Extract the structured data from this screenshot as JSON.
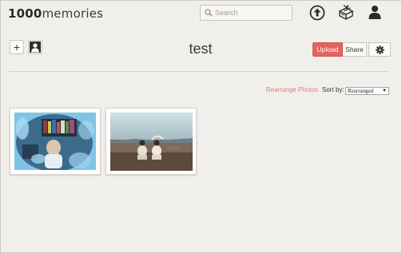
{
  "header": {
    "logo": {
      "bold": "1000",
      "rest": "memories"
    },
    "search": {
      "placeholder": "Search"
    },
    "icons": [
      "upload-arrow-icon",
      "gift-box-icon",
      "user-icon"
    ]
  },
  "album": {
    "title": "test",
    "add_label": "+",
    "upload_label": "Upload",
    "share_label": "Share",
    "colors": {
      "accent": "#e2645e",
      "link": "#e07a70",
      "background": "#f1efeb"
    }
  },
  "toolbar": {
    "rearrange_label": "Rearrange Photos",
    "sort_label": "Sort by:",
    "sort_value": "Rearranged"
  },
  "photos": [
    {
      "name": "child-photo"
    },
    {
      "name": "two-men-beach-photo"
    }
  ]
}
